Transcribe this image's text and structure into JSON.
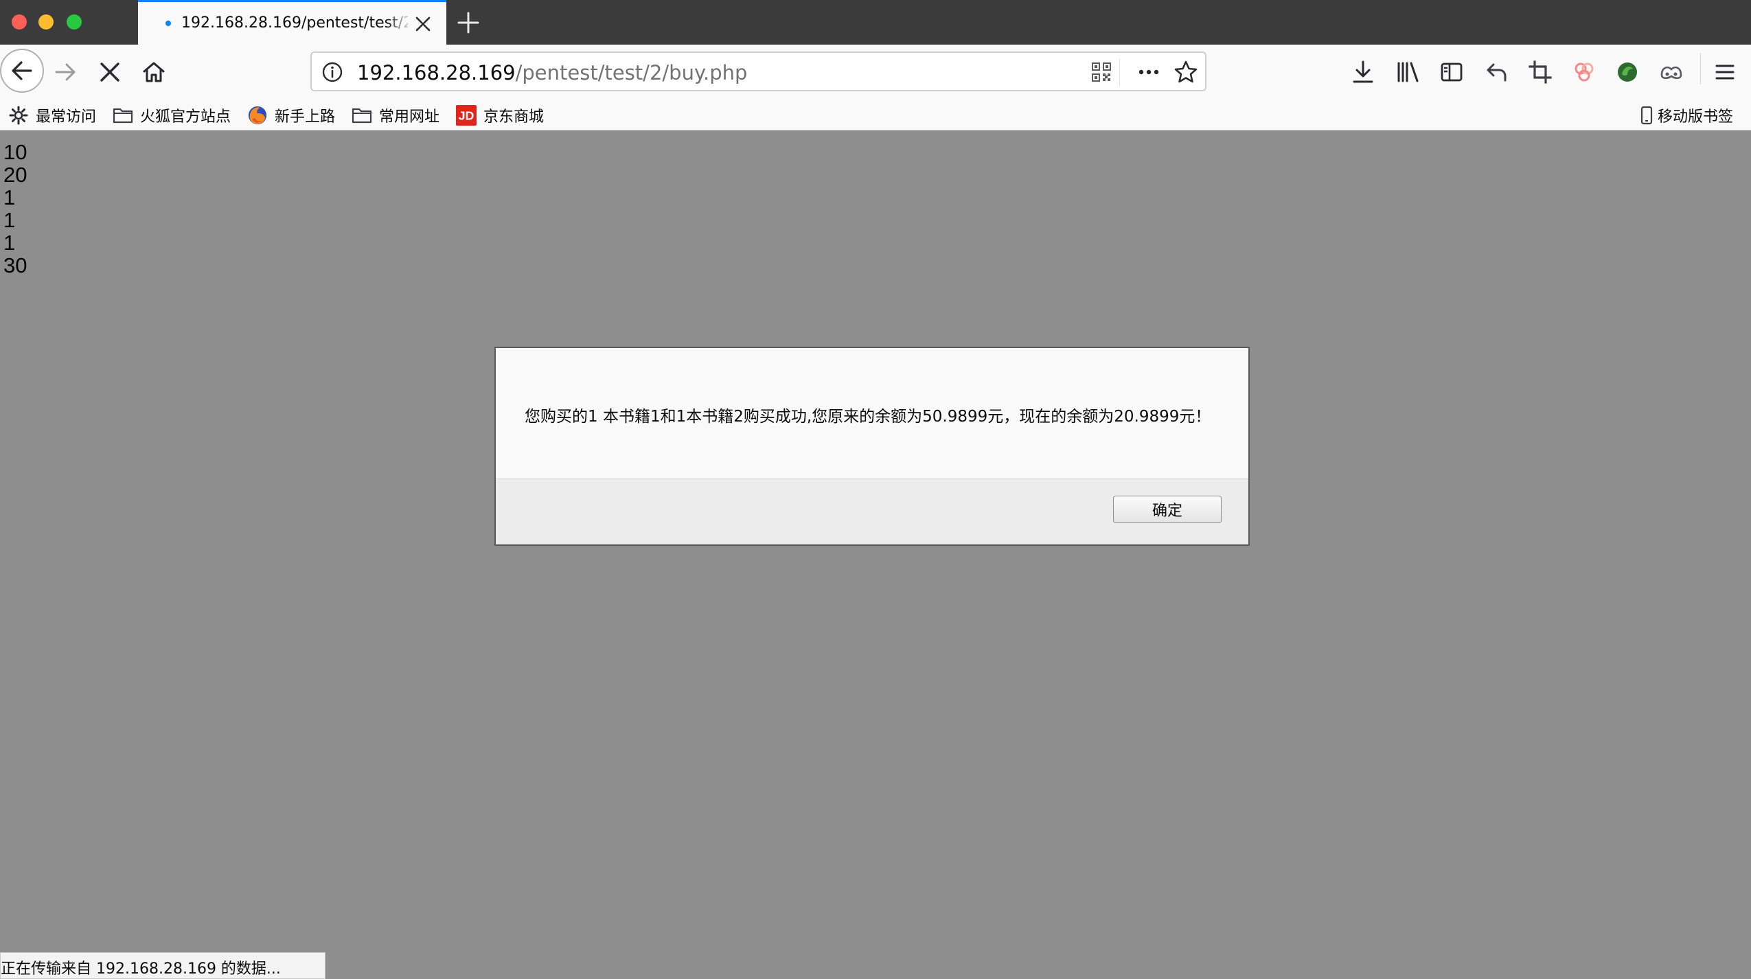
{
  "tab": {
    "title": "192.168.28.169/pentest/test/2/buy.php"
  },
  "urlbar": {
    "host": "192.168.28.169",
    "path": "/pentest/test/2/buy.php"
  },
  "bookmarks": {
    "items": [
      {
        "label": "最常访问",
        "icon": "gear-icon"
      },
      {
        "label": "火狐官方站点",
        "icon": "folder-icon"
      },
      {
        "label": "新手上路",
        "icon": "firefox-icon"
      },
      {
        "label": "常用网址",
        "icon": "folder-icon"
      },
      {
        "label": "京东商城",
        "icon": "jd-icon"
      }
    ],
    "mobile": {
      "label": "移动版书签",
      "icon": "mobile-icon"
    }
  },
  "page": {
    "lines": [
      "10",
      "20",
      "1",
      "1",
      "1",
      "30"
    ]
  },
  "dialog": {
    "message": "您购买的1 本书籍1和1本书籍2购买成功,您原来的余额为50.9899元，现在的余额为20.9899元！",
    "ok_label": "确定"
  },
  "status": {
    "text": "正在传输来自 192.168.28.169 的数据..."
  },
  "colors": {
    "tab_accent": "#0a84ff",
    "page_background": "#8e8e8e",
    "jd_red": "#e1251b"
  }
}
